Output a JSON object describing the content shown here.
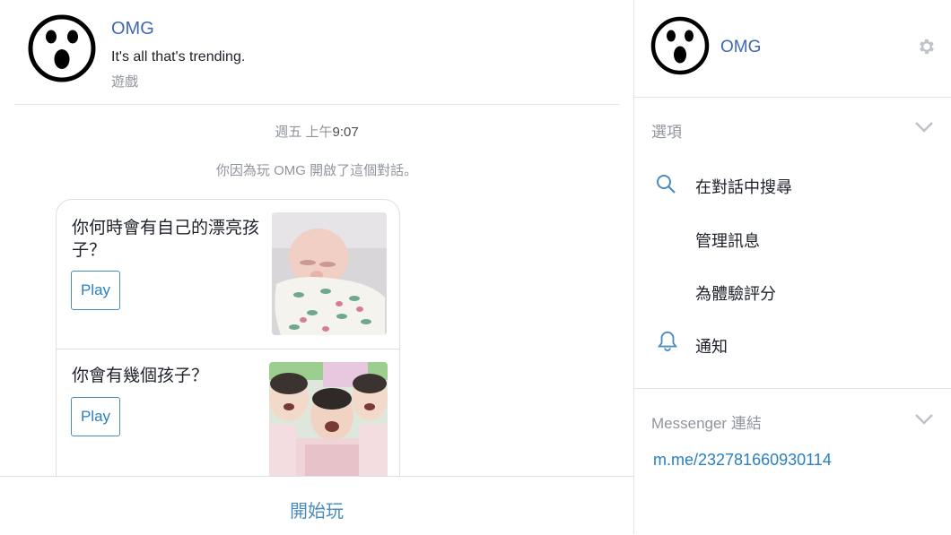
{
  "header": {
    "name": "OMG",
    "tagline": "It's all that's trending.",
    "category": "遊戲"
  },
  "conversation": {
    "timestamp_prefix": "週五 上午",
    "timestamp_time": "9:07",
    "notice": "你因為玩 OMG 開啟了這個對話。"
  },
  "cards": [
    {
      "title": "你何時會有自己的漂亮孩子？",
      "button": "Play",
      "image": "swaddled-baby"
    },
    {
      "title": "你會有幾個孩子？",
      "button": "Play",
      "image": "three-kids"
    }
  ],
  "bottom": {
    "start_label": "開始玩"
  },
  "sidebar": {
    "name": "OMG",
    "options_title": "選項",
    "options": [
      {
        "label": "在對話中搜尋",
        "icon": "search-icon"
      },
      {
        "label": "管理訊息",
        "icon": ""
      },
      {
        "label": "為體驗評分",
        "icon": ""
      },
      {
        "label": "通知",
        "icon": "bell-icon"
      }
    ],
    "messenger_title": "Messenger 連結",
    "messenger_link": "m.me/232781660930114"
  },
  "colors": {
    "accent": "#4267b2",
    "link": "#2a80c1",
    "muted": "#90949c"
  }
}
